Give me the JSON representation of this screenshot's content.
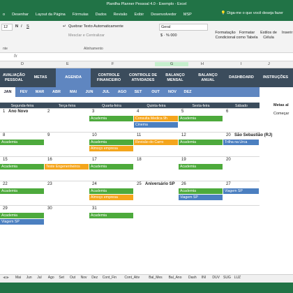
{
  "window": {
    "title": "Planilha Planner Pessoal 4.0 - Exemplo - Excel"
  },
  "ribbon_tabs": [
    "o",
    "Desenhar",
    "Layout da Página",
    "Fórmulas",
    "Dados",
    "Revisão",
    "Exibir",
    "Desenvolvedor",
    "MSP"
  ],
  "tell_me": "Diga-me o que você deseja fazer",
  "ribbon": {
    "font_size": "12",
    "wrap_text": "Quebrar Texto Automaticamente",
    "merge_center": "Mesclar e Centralizar",
    "number_format": "Geral",
    "alignment_label": "Alinhamento",
    "conditional_format": "Formatação Condicional",
    "format_table": "Formatar como Tabela",
    "cell_styles": "Estilos de Célula",
    "insert": "Inserir",
    "fonte_label": "nte"
  },
  "formula_bar": {
    "fx": "fx"
  },
  "column_headers": [
    "D",
    "E",
    "F",
    "G",
    "H",
    "I",
    "J"
  ],
  "nav": [
    {
      "label": "AVALIAÇÃO PESSOAL",
      "active": false
    },
    {
      "label": "METAS",
      "active": false
    },
    {
      "label": "AGENDA",
      "active": true
    },
    {
      "label": "CONTROLE FINANCEIRO",
      "active": false
    },
    {
      "label": "CONTROLE DE ATIVIDADES",
      "active": false
    },
    {
      "label": "BALANÇO MENSAL",
      "active": false
    },
    {
      "label": "BALANÇO ANUAL",
      "active": false
    },
    {
      "label": "DASHBOARD",
      "active": false
    },
    {
      "label": "INSTRUÇÕES",
      "active": false
    }
  ],
  "months": [
    "JAN",
    "FEV",
    "MAR",
    "ABR",
    "MAI",
    "JUN",
    "JUL",
    "AGO",
    "SET",
    "OUT",
    "NOV",
    "DEZ"
  ],
  "active_month": "JAN",
  "weekdays": [
    "Segunda-feira",
    "Terça-feira",
    "Quarta-feira",
    "Quinta-feira",
    "Sexta-feira",
    "Sábado"
  ],
  "calendar": [
    {
      "days": [
        {
          "num": "1",
          "label": "Ano Novo",
          "events": []
        },
        {
          "num": "2",
          "label": "",
          "events": []
        },
        {
          "num": "3",
          "label": "",
          "events": [
            {
              "text": "Academia",
              "color": "green"
            }
          ]
        },
        {
          "num": "4",
          "label": "",
          "events": [
            {
              "text": "Consulta Medica 9h",
              "color": "orange"
            },
            {
              "text": "Cinema",
              "color": "blue"
            }
          ]
        },
        {
          "num": "5",
          "label": "",
          "events": [
            {
              "text": "Academia",
              "color": "green"
            }
          ]
        },
        {
          "num": "6",
          "label": "",
          "events": []
        }
      ]
    },
    {
      "days": [
        {
          "num": "8",
          "label": "",
          "events": [
            {
              "text": "Academia",
              "color": "green"
            }
          ]
        },
        {
          "num": "9",
          "label": "",
          "events": []
        },
        {
          "num": "10",
          "label": "",
          "events": [
            {
              "text": "Academia",
              "color": "green"
            },
            {
              "text": "Almoço empresa",
              "color": "orange"
            }
          ]
        },
        {
          "num": "11",
          "label": "",
          "events": [
            {
              "text": "Revisão do Carro",
              "color": "orange"
            }
          ]
        },
        {
          "num": "12",
          "label": "",
          "events": [
            {
              "text": "Academia",
              "color": "green"
            }
          ]
        },
        {
          "num": "20",
          "label": "São Sebastião (RJ)",
          "events": [
            {
              "text": "Trilha na Urca",
              "color": "blue"
            }
          ]
        }
      ]
    },
    {
      "days": [
        {
          "num": "15",
          "label": "",
          "events": [
            {
              "text": "Academia",
              "color": "green"
            }
          ]
        },
        {
          "num": "16",
          "label": "",
          "events": [
            {
              "text": "Teste Engenenheiros",
              "color": "orange"
            }
          ]
        },
        {
          "num": "17",
          "label": "",
          "events": [
            {
              "text": "Academia",
              "color": "green"
            }
          ]
        },
        {
          "num": "18",
          "label": "",
          "events": []
        },
        {
          "num": "19",
          "label": "",
          "events": [
            {
              "text": "Academia",
              "color": "green"
            }
          ]
        },
        {
          "num": "20",
          "label": "",
          "events": []
        }
      ]
    },
    {
      "days": [
        {
          "num": "22",
          "label": "",
          "events": [
            {
              "text": "Academia",
              "color": "green"
            }
          ]
        },
        {
          "num": "23",
          "label": "",
          "events": []
        },
        {
          "num": "24",
          "label": "",
          "events": [
            {
              "text": "Academia",
              "color": "green"
            },
            {
              "text": "Almoço empresa",
              "color": "orange"
            }
          ]
        },
        {
          "num": "25",
          "label": "Aniversário SP",
          "events": []
        },
        {
          "num": "26",
          "label": "",
          "events": [
            {
              "text": "Academia",
              "color": "green"
            },
            {
              "text": "Viagem SP",
              "color": "blue"
            }
          ]
        },
        {
          "num": "27",
          "label": "",
          "events": [
            {
              "text": "Viagem SP",
              "color": "blue"
            }
          ]
        }
      ]
    },
    {
      "days": [
        {
          "num": "29",
          "label": "",
          "events": [
            {
              "text": "Academia",
              "color": "green"
            },
            {
              "text": "Viagem SP",
              "color": "blue"
            }
          ]
        },
        {
          "num": "30",
          "label": "",
          "events": []
        },
        {
          "num": "31",
          "label": "",
          "events": [
            {
              "text": "Academia",
              "color": "green"
            }
          ]
        },
        {
          "num": "",
          "label": "",
          "events": []
        },
        {
          "num": "",
          "label": "",
          "events": []
        },
        {
          "num": "",
          "label": "",
          "events": []
        }
      ]
    }
  ],
  "side_panel": {
    "title": "Metas al",
    "line": "Começar"
  },
  "sheet_tabs": [
    "Mai",
    "Jun",
    "Jul",
    "Ago",
    "Set",
    "Out",
    "Nov",
    "Dez",
    "Cont_Fin",
    "Cont_Ativ",
    "Bal_Mes",
    "Bal_Ano",
    "Dash",
    "INI",
    "DUV",
    "SUG",
    "LUZ"
  ],
  "colors": {
    "excel_green": "#217346",
    "nav_dark": "#3b4c5c",
    "accent_blue": "#5f86c0",
    "event_green": "#4daa3c",
    "event_orange": "#f4a51c",
    "event_blue": "#4b7fc0"
  }
}
